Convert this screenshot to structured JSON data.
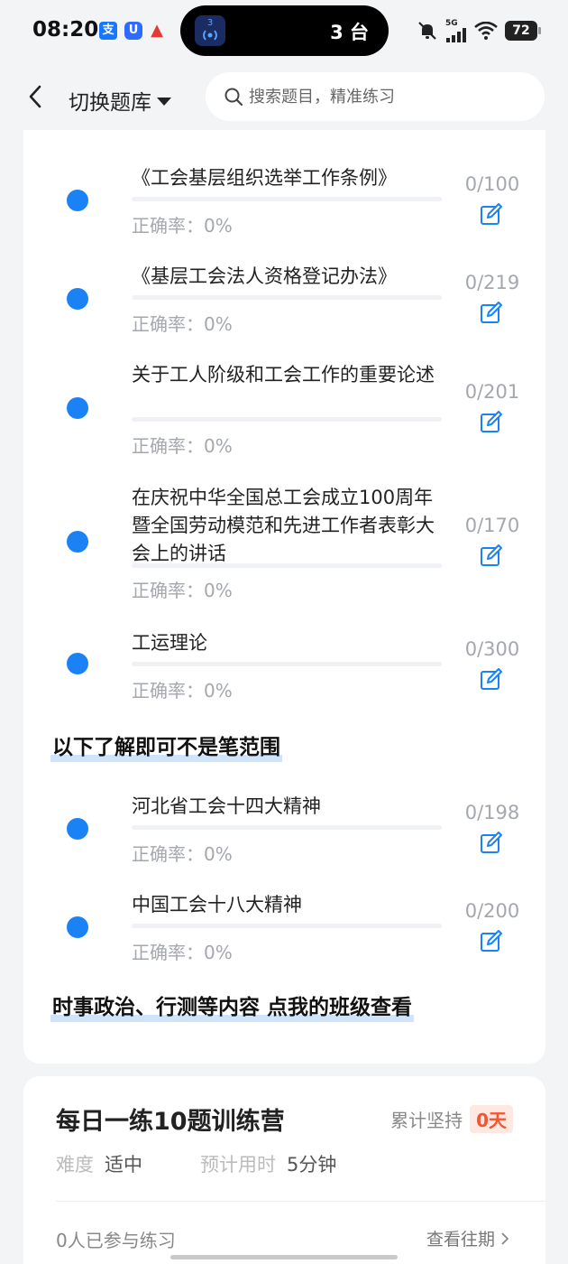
{
  "status_bar": {
    "time": "08:20",
    "app_icons": [
      {
        "name": "alipay-icon",
        "glyph": "支",
        "color": "#1677ff"
      },
      {
        "name": "shield-app-icon",
        "glyph": "U",
        "color": "#2f6bff"
      },
      {
        "name": "triangle-app-icon",
        "glyph": "▲",
        "color": "#e53935"
      }
    ],
    "island_badge": "3",
    "island_text": "3 台",
    "network": "5G",
    "battery": "72"
  },
  "nav": {
    "title": "切换题库",
    "search_placeholder": "搜索题目，精准练习"
  },
  "chapters": [
    {
      "title": "《工会基层组织选举工作条例》",
      "accuracy": "正确率：0%",
      "count": "0/100",
      "progress": 0
    },
    {
      "title": "《基层工会法人资格登记办法》",
      "accuracy": "正确率：0%",
      "count": "0/219",
      "progress": 0
    },
    {
      "title": "关于工人阶级和工会工作的重要论述",
      "accuracy": "正确率：0%",
      "count": "0/201",
      "progress": 0
    },
    {
      "title": "在庆祝中华全国总工会成立100周年暨全国劳动模范和先进工作者表彰大会上的讲话",
      "accuracy": "正确率：0%",
      "count": "0/170",
      "progress": 0
    },
    {
      "title": "工运理论",
      "accuracy": "正确率：0%",
      "count": "0/300",
      "progress": 0
    }
  ],
  "section_note_1": "以下了解即可不是笔范围",
  "extra_chapters": [
    {
      "title": "河北省工会十四大精神",
      "accuracy": "正确率：0%",
      "count": "0/198",
      "progress": 0
    },
    {
      "title": "中国工会十八大精神",
      "accuracy": "正确率：0%",
      "count": "0/200",
      "progress": 0
    }
  ],
  "section_note_2": "时事政治、行测等内容 点我的班级查看",
  "daily": {
    "title": "每日一练10题训练营",
    "streak_label": "累计坚持",
    "streak_value": "0天",
    "difficulty_label": "难度",
    "difficulty_value": "适中",
    "time_label": "预计用时",
    "time_value": "5分钟",
    "joined": "0人已参与练习",
    "history": "查看往期"
  },
  "colors": {
    "accent": "#1a82f5",
    "streak": "#f5542c"
  }
}
